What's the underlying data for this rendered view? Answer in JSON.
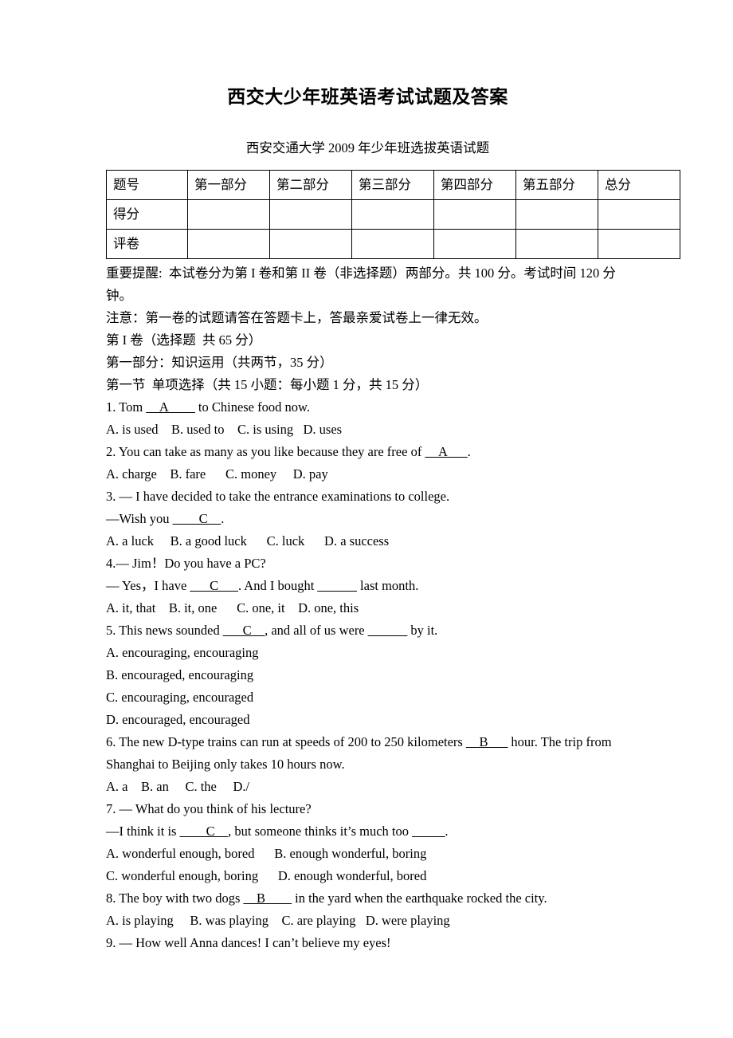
{
  "document": {
    "title": "西交大少年班英语考试试题及答案",
    "subtitle": "西安交通大学 2009  年少年班选拔英语试题"
  },
  "score_table": {
    "rows": [
      [
        "题号",
        "第一部分",
        "第二部分",
        "第三部分",
        "第四部分",
        "第五部分",
        "总分"
      ],
      [
        "得分",
        "",
        "",
        "",
        "",
        "",
        ""
      ],
      [
        "评卷",
        "",
        "",
        "",
        "",
        "",
        ""
      ]
    ]
  },
  "notices": {
    "important": "重要提醒:  本试卷分为第 I 卷和第 II 卷（非选择题）两部分。共 100 分。考试时间 120 分钟。",
    "attention": "注意：第一卷的试题请答在答题卡上，答最亲爱试卷上一律无效。",
    "paper_one": "第 I 卷（选择题  共 65 分）",
    "part_one": "第一部分：知识运用（共两节，35 分）",
    "section_one": "第一节  单项选择（共 15 小题：每小题 1 分，共 15 分）"
  },
  "questions": [
    {
      "id": "q1",
      "stem_pre": "1. Tom ",
      "stem_blank": "__A____",
      "stem_post": " to Chinese food now.",
      "options_lines": [
        "A. is used    B. used to    C. is using   D. uses"
      ]
    },
    {
      "id": "q2",
      "stem_pre": "2. You can take as many as you like because they are free of ",
      "stem_blank": "__A___",
      "stem_post": ".",
      "options_lines": [
        "A. charge    B. fare      C. money     D. pay"
      ]
    },
    {
      "id": "q3",
      "stem_line_1": "3. — I have decided to take the entrance examinations to college.",
      "stem_pre": "—Wish you ",
      "stem_blank": "____C__",
      "stem_post": ".",
      "options_lines": [
        "A. a luck     B. a good luck      C. luck      D. a success"
      ]
    },
    {
      "id": "q4",
      "stem_line_1": "4.— Jim！Do you have a PC?",
      "stem_pre": "— Yes，I have ",
      "stem_blank": "___C___",
      "stem_mid": ". And I bought ",
      "stem_blank2": "______",
      "stem_post": " last month.",
      "options_lines": [
        "A. it, that    B. it, one      C. one, it    D. one, this"
      ]
    },
    {
      "id": "q5",
      "stem_pre": "5. This news sounded ",
      "stem_blank": "___C__",
      "stem_mid": ", and all of us were ",
      "stem_blank2": "______",
      "stem_post": " by it.",
      "options_lines": [
        "A. encouraging, encouraging",
        "B. encouraged, encouraging",
        "C. encouraging, encouraged",
        "D. encouraged, encouraged"
      ]
    },
    {
      "id": "q6",
      "stem_pre": "6. The new D-type trains can run at speeds of 200 to 250 kilometers ",
      "stem_blank": "__B___",
      "stem_post": " hour. The trip from Shanghai to Beijing only takes 10 hours now.",
      "options_lines": [
        "A. a    B. an     C. the     D./"
      ]
    },
    {
      "id": "q7",
      "stem_line_1": "7. — What do you think of his lecture?",
      "stem_pre": "—I think it is ",
      "stem_blank": "____C__",
      "stem_mid": ", but someone thinks it’s much too ",
      "stem_blank2": "_____",
      "stem_post": ".",
      "options_lines": [
        "A. wonderful enough, bored      B. enough wonderful, boring",
        "C. wonderful enough, boring      D. enough wonderful, bored"
      ]
    },
    {
      "id": "q8",
      "stem_pre": "8. The boy with two dogs ",
      "stem_blank": "__B____",
      "stem_post": " in the yard when the earthquake rocked the city.",
      "options_lines": [
        "A. is playing     B. was playing    C. are playing   D. were playing"
      ]
    },
    {
      "id": "q9",
      "stem_line_1": "9. — How well Anna dances! I can’t believe my eyes!"
    }
  ]
}
